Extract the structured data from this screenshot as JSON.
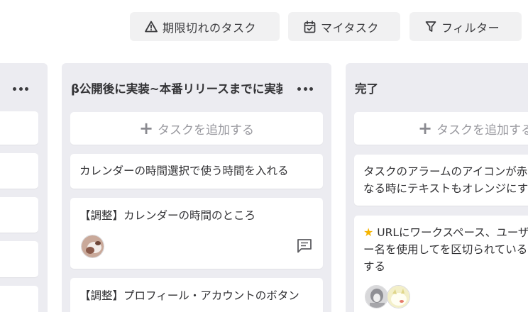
{
  "toolbar": {
    "overdue_label": "期限切れのタスク",
    "my_tasks_label": "マイタスク",
    "filter_label": "フィルター"
  },
  "columns": [
    {
      "title": "",
      "cards": [
        "",
        "",
        "",
        "",
        ""
      ]
    },
    {
      "title": "β公開後に実装~本番リリースまでに実装",
      "add_label": "タスクを追加する",
      "cards": [
        {
          "title": "カレンダーの時間選択で使う時間を入れる"
        },
        {
          "title": "【調整】カレンダーの時間のところ",
          "has_comment": true
        },
        {
          "title": "【調整】プロフィール・アカウントのボタン"
        }
      ]
    },
    {
      "title": "完了",
      "add_label": "タスクを追加する",
      "cards": [
        {
          "title": "タスクのアラームのアイコンが赤くなる時にテキストもオレンジにする"
        },
        {
          "title": "URLにワークスペース、ユーザー名を使用してを区切られているがする",
          "starred": true
        }
      ]
    }
  ],
  "icons": {
    "overdue": "warning-triangle-icon",
    "my_tasks": "calendar-check-icon",
    "filter": "filter-funnel-icon",
    "more": "more-horizontal-icon",
    "add": "plus-icon",
    "comment": "comment-icon",
    "star": "star-icon"
  },
  "colors": {
    "column_bg": "#ececf1",
    "star": "#f5b400"
  }
}
